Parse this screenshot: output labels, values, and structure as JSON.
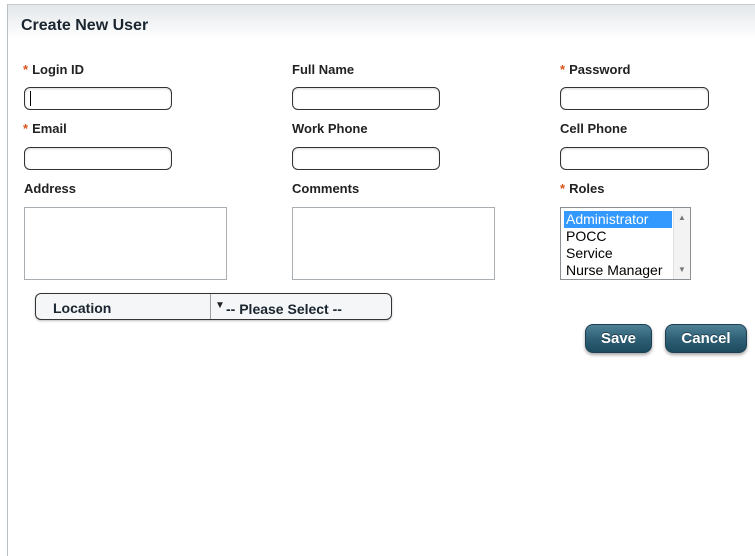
{
  "header": {
    "title": "Create New User"
  },
  "fields": {
    "login_id": {
      "label": "Login ID",
      "required": "*",
      "value": ""
    },
    "full_name": {
      "label": "Full Name",
      "value": ""
    },
    "password": {
      "label": "Password",
      "required": "*",
      "value": ""
    },
    "email": {
      "label": "Email",
      "required": "*",
      "value": ""
    },
    "work_phone": {
      "label": "Work Phone",
      "value": ""
    },
    "cell_phone": {
      "label": "Cell Phone",
      "value": ""
    },
    "address": {
      "label": "Address",
      "value": ""
    },
    "comments": {
      "label": "Comments",
      "value": ""
    },
    "roles": {
      "label": "Roles",
      "required": "*",
      "options": [
        "Administrator",
        "POCC",
        "Service",
        "Nurse Manager"
      ],
      "selected": "Administrator"
    },
    "location": {
      "label": "Location",
      "selected": "-- Please Select --"
    }
  },
  "buttons": {
    "save": "Save",
    "cancel": "Cancel"
  },
  "colors": {
    "required_marker": "#d9531e",
    "button": "#2f6076",
    "selection": "#3399ff"
  }
}
